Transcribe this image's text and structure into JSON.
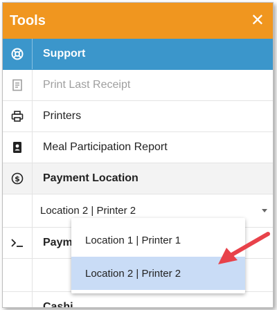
{
  "panel": {
    "title": "Tools",
    "close_label": "✕"
  },
  "menu": {
    "support": "Support",
    "print_last_receipt": "Print Last Receipt",
    "printers": "Printers",
    "meal_participation_report": "Meal Participation Report",
    "payment_location": "Payment Location",
    "payment_location_value": "Location 2 | Printer 2",
    "payment_terminal_partial": "Paym",
    "cashier_partial": "Cashi"
  },
  "dropdown": {
    "options": [
      "Location 1 | Printer 1",
      "Location 2 | Printer 2"
    ],
    "selected_index": 1
  },
  "colors": {
    "header": "#f0961f",
    "active_row": "#3b96cb",
    "selected_option": "#c9dcf6",
    "arrow": "#e8424a"
  }
}
